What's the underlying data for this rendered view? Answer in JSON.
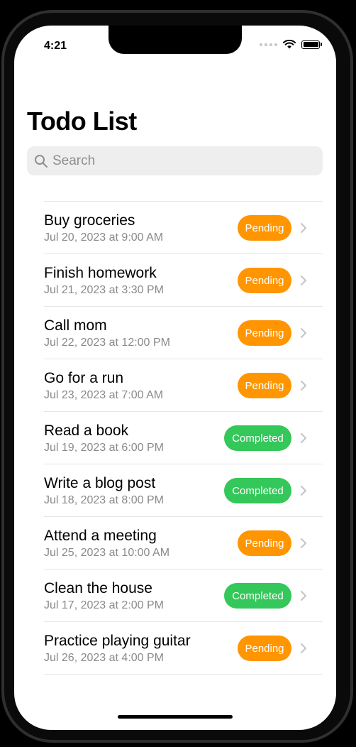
{
  "status_bar": {
    "time": "4:21"
  },
  "header": {
    "title": "Todo List"
  },
  "search": {
    "placeholder": "Search"
  },
  "colors": {
    "pending": "#FF9500",
    "completed": "#34C759"
  },
  "todos": [
    {
      "title": "Buy groceries",
      "date": "Jul 20, 2023 at 9:00 AM",
      "status": "Pending"
    },
    {
      "title": "Finish homework",
      "date": "Jul 21, 2023 at 3:30 PM",
      "status": "Pending"
    },
    {
      "title": "Call mom",
      "date": "Jul 22, 2023 at 12:00 PM",
      "status": "Pending"
    },
    {
      "title": "Go for a run",
      "date": "Jul 23, 2023 at 7:00 AM",
      "status": "Pending"
    },
    {
      "title": "Read a book",
      "date": "Jul 19, 2023 at 6:00 PM",
      "status": "Completed"
    },
    {
      "title": "Write a blog post",
      "date": "Jul 18, 2023 at 8:00 PM",
      "status": "Completed"
    },
    {
      "title": "Attend a meeting",
      "date": "Jul 25, 2023 at 10:00 AM",
      "status": "Pending"
    },
    {
      "title": "Clean the house",
      "date": "Jul 17, 2023 at 2:00 PM",
      "status": "Completed"
    },
    {
      "title": "Practice playing guitar",
      "date": "Jul 26, 2023 at 4:00 PM",
      "status": "Pending"
    }
  ]
}
